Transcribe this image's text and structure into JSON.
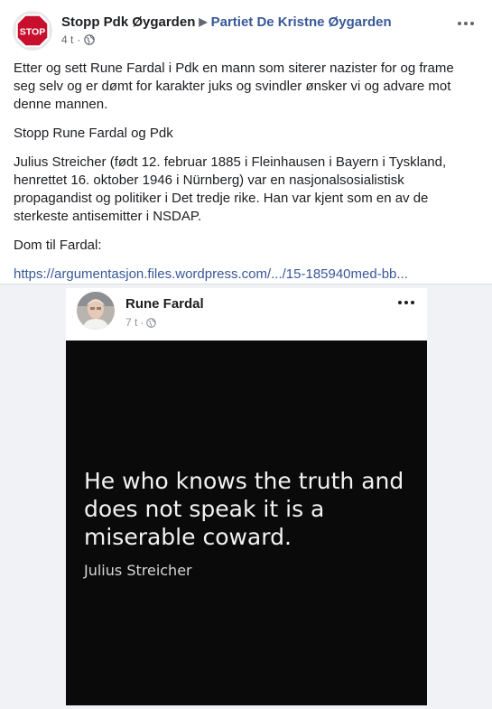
{
  "post": {
    "page_name": "Stopp Pdk Øygarden",
    "group_name": "Partiet De Kristne Øygarden",
    "time": "4 t",
    "avatar_label": "STOP",
    "paragraphs": [
      "Etter og sett Rune Fardal i Pdk en mann som siterer nazister for og frame seg selv og er dømt for karakter juks og svindler ønsker vi og advare mot denne mannen.",
      "Stopp Rune Fardal og Pdk",
      "Julius Streicher (født 12. februar 1885 i Fleinhausen i Bayern i Tyskland, henrettet 16. oktober 1946 i Nürnberg) var en nasjonalsosialistisk propagandist og politiker i Det tredje rike. Han var kjent som en av de sterkeste antisemitter i NSDAP.",
      "Dom til Fardal:"
    ],
    "link": "https://argumentasjon.files.wordpress.com/.../15-185940med-bb..."
  },
  "shared": {
    "author": "Rune Fardal",
    "time": "7 t",
    "quote_lines": [
      "He who knows the truth and",
      "does not speak it is a",
      "miserable coward."
    ],
    "quote_author": "Julius Streicher"
  },
  "icons": {
    "avatar": "stop-sign-icon",
    "privacy": "globe-icon",
    "menu": "more-options-icon",
    "separator": "triangle-right-icon"
  },
  "colors": {
    "link": "#385898",
    "stop_red": "#c8102e",
    "meta_gray": "#616770",
    "quote_bg": "#0a0a0a"
  }
}
